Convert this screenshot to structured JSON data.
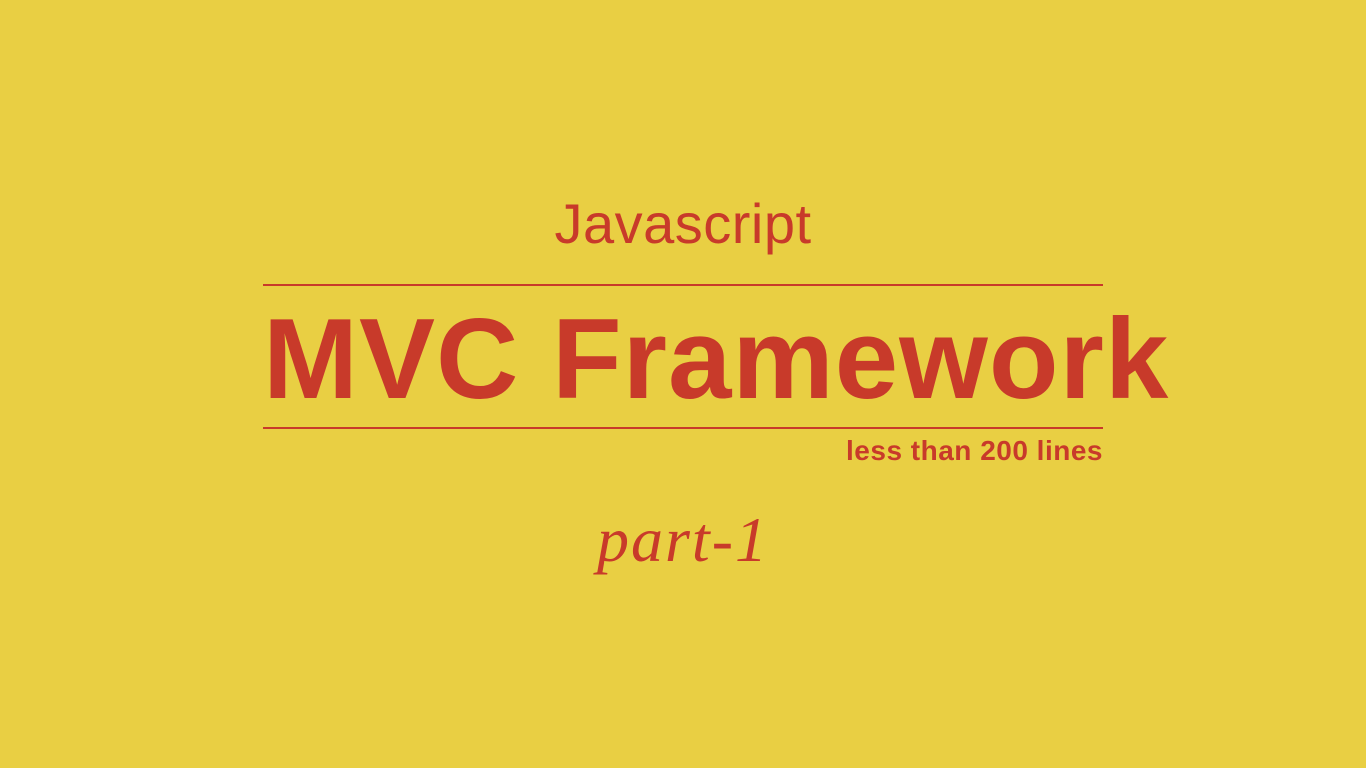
{
  "header": {
    "topLabel": "Javascript",
    "mainTitle": "MVC Framework",
    "subtitle": "less than 200 lines",
    "partLabel": "part-1"
  }
}
